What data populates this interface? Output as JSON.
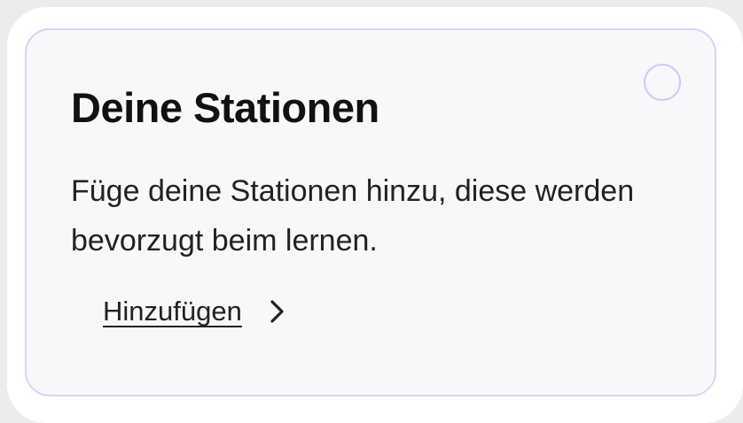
{
  "card": {
    "title": "Deine Stationen",
    "description": "Füge deine Stationen hinzu, diese werden bevorzugt beim lernen.",
    "action_label": "Hinzufügen",
    "selected": false
  },
  "colors": {
    "background": "#ececec",
    "card_border": "#d9d3f4",
    "radio_border": "#cfc8f2",
    "text": "#111111"
  },
  "icons": {
    "action": "chevron-right-icon",
    "select": "radio-circle-icon"
  }
}
